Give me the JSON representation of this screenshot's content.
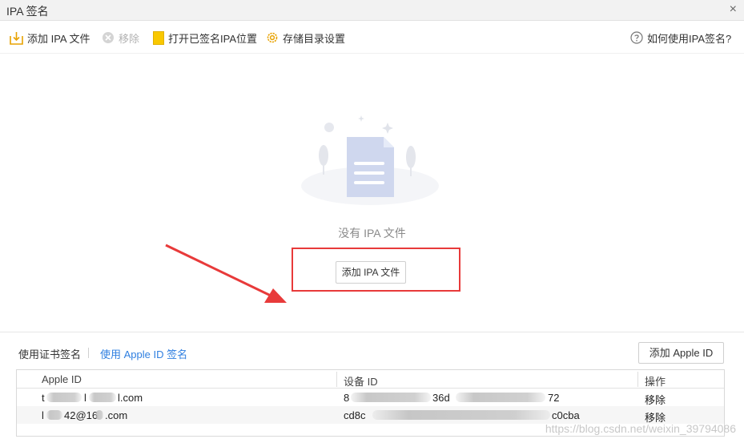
{
  "window": {
    "title": "IPA 签名",
    "close_glyph": "×"
  },
  "toolbar": {
    "add_ipa_label": "添加 IPA 文件",
    "remove_label": "移除",
    "open_signed_label": "打开已签名IPA位置",
    "storage_settings_label": "存储目录设置",
    "help_label": "如何使用IPA签名?"
  },
  "empty_state": {
    "message": "没有 IPA 文件",
    "add_button_label": "添加 IPA 文件"
  },
  "tabs": {
    "cert_sign": "使用证书签名",
    "apple_id_sign": "使用 Apple ID 签名"
  },
  "add_apple_id_label": "添加 Apple ID",
  "table": {
    "headers": [
      "Apple ID",
      "设备 ID",
      "操作"
    ],
    "rows": [
      {
        "apple_id_start": "t",
        "apple_id_mid": "l",
        "apple_id_end": "l.com",
        "device_id_start": "8",
        "device_id_mid": "36d",
        "device_id_end": "72",
        "action": "移除"
      },
      {
        "apple_id_start": "l",
        "apple_id_mid": "42@16",
        "apple_id_end": ".com",
        "device_id_start": "cd8c",
        "device_id_mid": "",
        "device_id_end": "c0cba",
        "action": "移除"
      }
    ]
  },
  "watermark": "https://blog.csdn.net/weixin_39794086",
  "colors": {
    "accent": "#2f7fe0",
    "highlight": "#e83a3a",
    "folder_icon": "#f5b800"
  }
}
